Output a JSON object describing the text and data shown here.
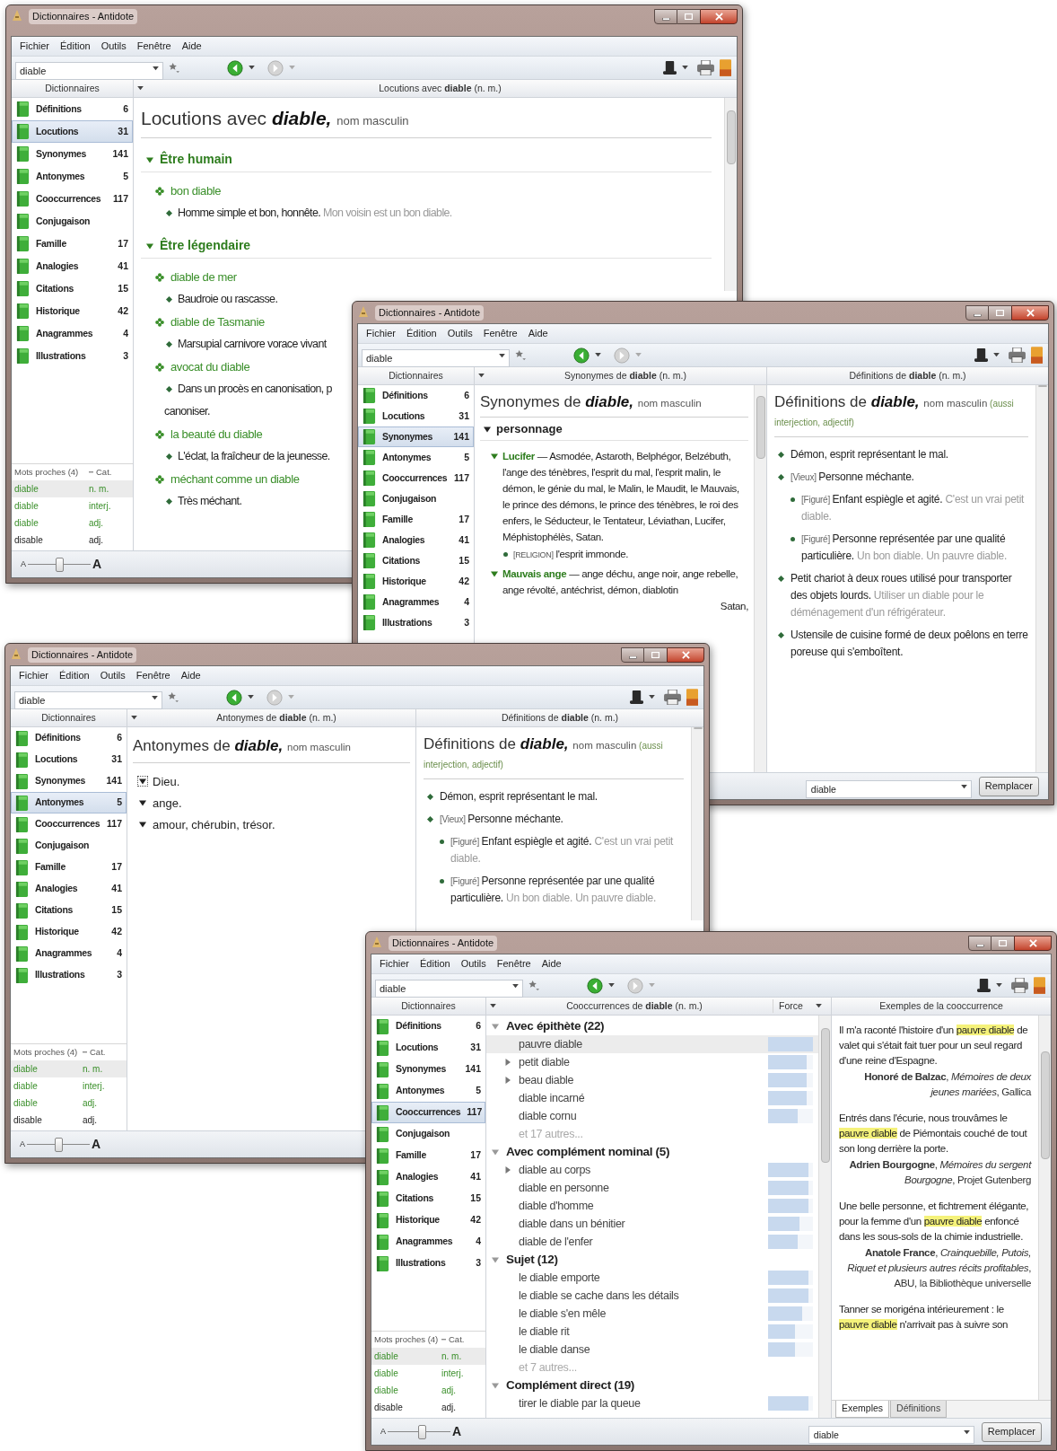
{
  "windows": [
    {
      "title": "Dictionnaires - Antidote",
      "menu": [
        "Fichier",
        "Édition",
        "Outils",
        "Fenêtre",
        "Aide"
      ],
      "search": {
        "value": "diable"
      },
      "sidebar": {
        "header": "Dictionnaires",
        "items": [
          {
            "label": "Définitions",
            "count": "6",
            "selected": false
          },
          {
            "label": "Locutions",
            "count": "31",
            "selected": true
          },
          {
            "label": "Synonymes",
            "count": "141",
            "selected": false
          },
          {
            "label": "Antonymes",
            "count": "5",
            "selected": false
          },
          {
            "label": "Cooccurrences",
            "count": "117",
            "selected": false
          },
          {
            "label": "Conjugaison",
            "selected": false
          },
          {
            "label": "Famille",
            "count": "17",
            "selected": false
          },
          {
            "label": "Analogies",
            "count": "41",
            "selected": false
          },
          {
            "label": "Citations",
            "count": "15",
            "selected": false
          },
          {
            "label": "Historique",
            "count": "42",
            "selected": false
          },
          {
            "label": "Anagrammes",
            "count": "4",
            "selected": false
          },
          {
            "label": "Illustrations",
            "count": "3",
            "selected": false
          }
        ],
        "nearby": {
          "header": "Mots proches (4)",
          "cat_header": "Cat.",
          "rows": [
            {
              "word": "diable",
              "cat": "n. m.",
              "match": true,
              "selected": true
            },
            {
              "word": "diable",
              "cat": "interj.",
              "match": true,
              "selected": false
            },
            {
              "word": "diable",
              "cat": "adj.",
              "match": true,
              "selected": false
            },
            {
              "word": "disable",
              "cat": "adj.",
              "match": false,
              "selected": false
            }
          ]
        }
      },
      "font_slider": {
        "small_label": "A",
        "large_label": "A",
        "level": 0.5
      },
      "panes": [
        {
          "kind": "locutions",
          "header": "Locutions avec **diable** (n. m.)",
          "heading": {
            "lead": "Locutions avec",
            "word": "diable,",
            "pos": "nom masculin"
          },
          "sections": [
            {
              "title": "Être humain",
              "expanded": true,
              "entries": [
                {
                  "phrase": "bon diable",
                  "senses": [
                    {
                      "text": "Homme simple et bon, honnête.",
                      "example": "Mon voisin est un bon diable."
                    }
                  ]
                }
              ]
            },
            {
              "title": "Être légendaire",
              "expanded": true,
              "entries": [
                {
                  "phrase": "diable de mer",
                  "senses": [
                    {
                      "text": "Baudroie ou rascasse."
                    }
                  ]
                },
                {
                  "phrase": "diable de Tasmanie",
                  "senses": [
                    {
                      "text": "Marsupial carnivore vorace vivant"
                    }
                  ]
                },
                {
                  "phrase": "avocat du diable",
                  "senses": [
                    {
                      "text": "Dans un procès en canonisation, p",
                      "continuation": "canoniser."
                    }
                  ]
                },
                {
                  "phrase": "la beauté du diable",
                  "senses": [
                    {
                      "text": "L'éclat, la fraîcheur de la jeunesse."
                    }
                  ]
                },
                {
                  "phrase": "méchant comme un diable",
                  "senses": [
                    {
                      "text": "Très méchant."
                    }
                  ]
                }
              ]
            }
          ]
        }
      ]
    },
    {
      "title": "Dictionnaires - Antidote",
      "menu": [
        "Fichier",
        "Édition",
        "Outils",
        "Fenêtre",
        "Aide"
      ],
      "search": {
        "value": "diable"
      },
      "sidebar": {
        "header": "Dictionnaires",
        "items": [
          {
            "label": "Définitions",
            "count": "6",
            "selected": false
          },
          {
            "label": "Locutions",
            "count": "31",
            "selected": false
          },
          {
            "label": "Synonymes",
            "count": "141",
            "selected": true
          },
          {
            "label": "Antonymes",
            "count": "5",
            "selected": false
          },
          {
            "label": "Cooccurrences",
            "count": "117",
            "selected": false
          },
          {
            "label": "Conjugaison",
            "selected": false
          },
          {
            "label": "Famille",
            "count": "17",
            "selected": false
          },
          {
            "label": "Analogies",
            "count": "41",
            "selected": false
          },
          {
            "label": "Citations",
            "count": "15",
            "selected": false
          },
          {
            "label": "Historique",
            "count": "42",
            "selected": false
          },
          {
            "label": "Anagrammes",
            "count": "4",
            "selected": false
          },
          {
            "label": "Illustrations",
            "count": "3",
            "selected": false
          }
        ]
      },
      "panes": [
        {
          "kind": "synonyms",
          "header": "Synonymes de **diable** (n. m.)",
          "heading": {
            "lead": "Synonymes de",
            "word": "diable,",
            "pos": "nom masculin"
          },
          "sections": [
            {
              "title": "personnage",
              "expanded": true,
              "entries": [
                {
                  "head": "Lucifer",
                  "expanded": true,
                  "text": "— Asmodée, Astaroth, Belphégor, Belzébuth, l'ange des ténèbres, l'esprit du mal, l'esprit malin, le démon, le génie du mal, le Malin, le Maudit, le Mauvais, le prince des démons, le prince des ténèbres, le roi des enfers, le Séducteur, le Tentateur, Léviathan, Lucifer, Méphistophélès, Satan.",
                  "subs": [
                    {
                      "label": "[RELIGION]",
                      "text": "l'esprit immonde."
                    }
                  ]
                },
                {
                  "head": "Mauvais ange",
                  "expanded": true,
                  "text": "— ange déchu, ange noir, ange rebelle, ange révolté, antéchrist, démon, diablotin",
                  "tail": "Satan,"
                }
              ]
            }
          ]
        },
        {
          "kind": "definitions",
          "header": "Définitions de **diable** (n. m.)",
          "heading": {
            "lead": "Définitions de",
            "word": "diable,",
            "pos": "nom masculin",
            "note": "(aussi interjection, adjectif)"
          },
          "senses": [
            {
              "kind": "main",
              "text": "Démon, esprit représentant le mal."
            },
            {
              "kind": "main",
              "label": "[Vieux]",
              "text": "Personne méchante."
            },
            {
              "kind": "sub",
              "label": "[Figuré]",
              "text": "Enfant espiègle et agité.",
              "example": "C'est un vrai petit diable."
            },
            {
              "kind": "sub",
              "label": "[Figuré]",
              "text": "Personne représentée par une qualité particulière.",
              "example": "Un bon diable. Un pauvre diable."
            },
            {
              "kind": "main",
              "text": "Petit chariot à deux roues utilisé pour transporter des objets lourds.",
              "example": "Utiliser un diable pour le déménagement d'un réfrigérateur."
            },
            {
              "kind": "main",
              "text": "Ustensile de cuisine formé de deux poêlons en terre poreuse qui s'emboîtent."
            }
          ]
        }
      ],
      "replace": {
        "value": "diable",
        "button": "Remplacer"
      }
    },
    {
      "title": "Dictionnaires - Antidote",
      "menu": [
        "Fichier",
        "Édition",
        "Outils",
        "Fenêtre",
        "Aide"
      ],
      "search": {
        "value": "diable"
      },
      "sidebar": {
        "header": "Dictionnaires",
        "items": [
          {
            "label": "Définitions",
            "count": "6",
            "selected": false
          },
          {
            "label": "Locutions",
            "count": "31",
            "selected": false
          },
          {
            "label": "Synonymes",
            "count": "141",
            "selected": false
          },
          {
            "label": "Antonymes",
            "count": "5",
            "selected": true
          },
          {
            "label": "Cooccurrences",
            "count": "117",
            "selected": false
          },
          {
            "label": "Conjugaison",
            "selected": false
          },
          {
            "label": "Famille",
            "count": "17",
            "selected": false
          },
          {
            "label": "Analogies",
            "count": "41",
            "selected": false
          },
          {
            "label": "Citations",
            "count": "15",
            "selected": false
          },
          {
            "label": "Historique",
            "count": "42",
            "selected": false
          },
          {
            "label": "Anagrammes",
            "count": "4",
            "selected": false
          },
          {
            "label": "Illustrations",
            "count": "3",
            "selected": false
          }
        ],
        "nearby": {
          "header": "Mots proches (4)",
          "cat_header": "Cat.",
          "rows": [
            {
              "word": "diable",
              "cat": "n. m.",
              "match": true,
              "selected": true
            },
            {
              "word": "diable",
              "cat": "interj.",
              "match": true,
              "selected": false
            },
            {
              "word": "diable",
              "cat": "adj.",
              "match": true,
              "selected": false
            },
            {
              "word": "disable",
              "cat": "adj.",
              "match": false,
              "selected": false
            }
          ]
        }
      },
      "font_slider": {
        "small_label": "A",
        "large_label": "A",
        "level": 0.5
      },
      "panes": [
        {
          "kind": "antonyms",
          "header": "Antonymes de **diable** (n. m.)",
          "heading": {
            "lead": "Antonymes de",
            "word": "diable,",
            "pos": "nom masculin"
          },
          "items": [
            {
              "text": "Dieu.",
              "focused": true
            },
            {
              "text": "ange.",
              "focused": false
            },
            {
              "text": "amour, chérubin, trésor.",
              "focused": false
            }
          ]
        },
        {
          "kind": "definitions",
          "header": "Définitions de **diable** (n. m.)",
          "heading": {
            "lead": "Définitions de",
            "word": "diable,",
            "pos": "nom masculin",
            "note": "(aussi interjection, adjectif)"
          },
          "senses": [
            {
              "kind": "main",
              "text": "Démon, esprit représentant le mal."
            },
            {
              "kind": "main",
              "label": "[Vieux]",
              "text": "Personne méchante."
            },
            {
              "kind": "sub",
              "label": "[Figuré]",
              "text": "Enfant espiègle et agité.",
              "example": "C'est un vrai petit diable."
            },
            {
              "kind": "sub",
              "label": "[Figuré]",
              "text": "Personne représentée par une qualité particulière.",
              "example": "Un bon diable. Un pauvre diable."
            }
          ]
        }
      ]
    },
    {
      "title": "Dictionnaires - Antidote",
      "menu": [
        "Fichier",
        "Édition",
        "Outils",
        "Fenêtre",
        "Aide"
      ],
      "search": {
        "value": "diable"
      },
      "sidebar": {
        "header": "Dictionnaires",
        "items": [
          {
            "label": "Définitions",
            "count": "6",
            "selected": false
          },
          {
            "label": "Locutions",
            "count": "31",
            "selected": false
          },
          {
            "label": "Synonymes",
            "count": "141",
            "selected": false
          },
          {
            "label": "Antonymes",
            "count": "5",
            "selected": false
          },
          {
            "label": "Cooccurrences",
            "count": "117",
            "selected": true
          },
          {
            "label": "Conjugaison",
            "selected": false
          },
          {
            "label": "Famille",
            "count": "17",
            "selected": false
          },
          {
            "label": "Analogies",
            "count": "41",
            "selected": false
          },
          {
            "label": "Citations",
            "count": "15",
            "selected": false
          },
          {
            "label": "Historique",
            "count": "42",
            "selected": false
          },
          {
            "label": "Anagrammes",
            "count": "4",
            "selected": false
          },
          {
            "label": "Illustrations",
            "count": "3",
            "selected": false
          }
        ],
        "nearby": {
          "header": "Mots proches (4)",
          "cat_header": "Cat.",
          "rows": [
            {
              "word": "diable",
              "cat": "n. m.",
              "match": true,
              "selected": true
            },
            {
              "word": "diable",
              "cat": "interj.",
              "match": true,
              "selected": false
            },
            {
              "word": "diable",
              "cat": "adj.",
              "match": true,
              "selected": false
            },
            {
              "word": "disable",
              "cat": "adj.",
              "match": false,
              "selected": false
            }
          ]
        }
      },
      "font_slider": {
        "small_label": "A",
        "large_label": "A",
        "level": 0.55
      },
      "panes": [
        {
          "kind": "cooccurrences",
          "header": "Cooccurrences de **diable** (n. m.)",
          "force_header": "Force",
          "rows": [
            {
              "kind": "group",
              "text": "Avec épithète (22)",
              "selected": false
            },
            {
              "kind": "item",
              "text": "pauvre diable",
              "selected": true,
              "level": 1
            },
            {
              "kind": "parent",
              "text": "petit diable",
              "selected": false,
              "level": 0.85
            },
            {
              "kind": "parent",
              "text": "beau diable",
              "selected": false,
              "level": 0.85
            },
            {
              "kind": "item",
              "text": "diable incarné",
              "selected": false,
              "level": 0.85
            },
            {
              "kind": "item",
              "text": "diable cornu",
              "selected": false,
              "level": 0.65
            },
            {
              "kind": "more",
              "text": "et 17 autres...",
              "selected": false
            },
            {
              "kind": "group",
              "text": "Avec complément nominal (5)",
              "selected": false
            },
            {
              "kind": "parent",
              "text": "diable au corps",
              "selected": false,
              "level": 0.9
            },
            {
              "kind": "item",
              "text": "diable en personne",
              "selected": false,
              "level": 0.9
            },
            {
              "kind": "item",
              "text": "diable d'homme",
              "selected": false,
              "level": 0.9
            },
            {
              "kind": "item",
              "text": "diable dans un bénitier",
              "selected": false,
              "level": 0.7
            },
            {
              "kind": "item",
              "text": "diable de l'enfer",
              "selected": false,
              "level": 0.65
            },
            {
              "kind": "group",
              "text": "Sujet (12)",
              "selected": false
            },
            {
              "kind": "item",
              "text": "le diable emporte",
              "selected": false,
              "level": 0.9
            },
            {
              "kind": "item",
              "text": "le diable se cache dans les détails",
              "selected": false,
              "level": 0.9
            },
            {
              "kind": "item",
              "text": "le diable s'en mêle",
              "selected": false,
              "level": 0.75
            },
            {
              "kind": "item",
              "text": "le diable rit",
              "selected": false,
              "level": 0.6
            },
            {
              "kind": "item",
              "text": "le diable danse",
              "selected": false,
              "level": 0.6
            },
            {
              "kind": "more",
              "text": "et 7 autres...",
              "selected": false
            },
            {
              "kind": "group",
              "text": "Complément direct (19)",
              "selected": false
            },
            {
              "kind": "item",
              "text": "tirer le diable par la queue",
              "selected": false,
              "level": 0.9
            }
          ]
        },
        {
          "kind": "examples",
          "header": "Exemples de la cooccurrence",
          "quotes": [
            {
              "parts": [
                {
                  "text": "Il m'a raconté l'histoire d'un ",
                  "highlight": false
                },
                {
                  "text": "pauvre diable",
                  "highlight": true
                },
                {
                  "text": " de valet qui s'était fait tuer pour un seul regard d'une reine d'Espagne.",
                  "highlight": false
                }
              ],
              "source": "**Honoré de Balzac**, *Mémoires de deux jeunes mariées*, Gallica"
            },
            {
              "parts": [
                {
                  "text": "Entrés dans l'écurie, nous trouvâmes le ",
                  "highlight": false
                },
                {
                  "text": "pauvre diable",
                  "highlight": true
                },
                {
                  "text": " de Piémontais couché de tout son long derrière la porte.",
                  "highlight": false
                }
              ],
              "source": "**Adrien Bourgogne**, *Mémoires du sergent Bourgogne*, Projet Gutenberg"
            },
            {
              "parts": [
                {
                  "text": "Une belle personne, et fichtrement élégante, pour la femme d'un ",
                  "highlight": false
                },
                {
                  "text": "pauvre diable",
                  "highlight": true
                },
                {
                  "text": " enfoncé dans les sous-sols de la chimie industrielle.",
                  "highlight": false
                }
              ],
              "source": "**Anatole France**, *Crainquebille, Putois, Riquet et plusieurs autres récits profitables*, ABU, la Bibliothèque universelle"
            },
            {
              "parts": [
                {
                  "text": "Tanner se morigéna intérieurement : le ",
                  "highlight": false
                },
                {
                  "text": "pauvre diable",
                  "highlight": true
                },
                {
                  "text": " n'arrivait pas à suivre son",
                  "highlight": false
                }
              ]
            }
          ],
          "tabs": [
            {
              "label": "Exemples",
              "selected": true
            },
            {
              "label": "Définitions",
              "selected": false
            }
          ]
        }
      ],
      "replace": {
        "value": "diable",
        "button": "Remplacer"
      }
    }
  ]
}
